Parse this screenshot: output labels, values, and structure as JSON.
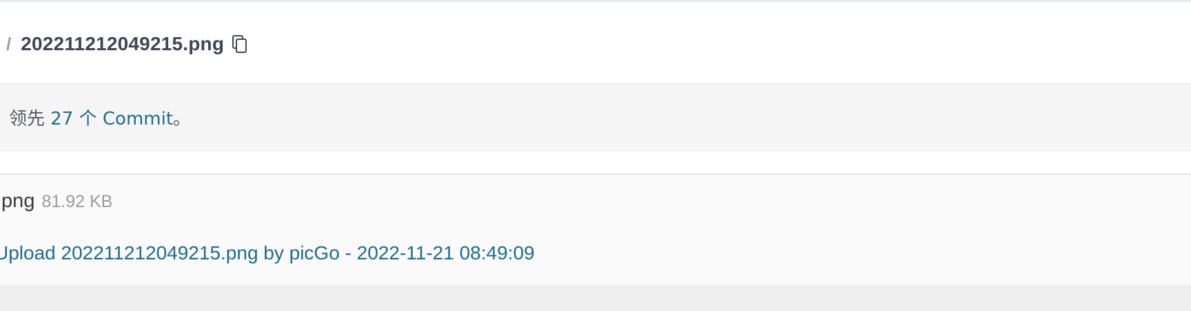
{
  "breadcrumb": {
    "separator": "/",
    "file_name": "202211212049215.png",
    "copy_icon": "copy-icon"
  },
  "ahead": {
    "prefix": "领先 ",
    "link": "27 个 Commit",
    "suffix": "。"
  },
  "file": {
    "name": ".png",
    "size": "81.92 KB",
    "commit_message": "Upload 202211212049215.png by picGo - 2022-11-21 08:49:09"
  },
  "colors": {
    "link": "#1e6b8c",
    "title": "#3f4654"
  }
}
